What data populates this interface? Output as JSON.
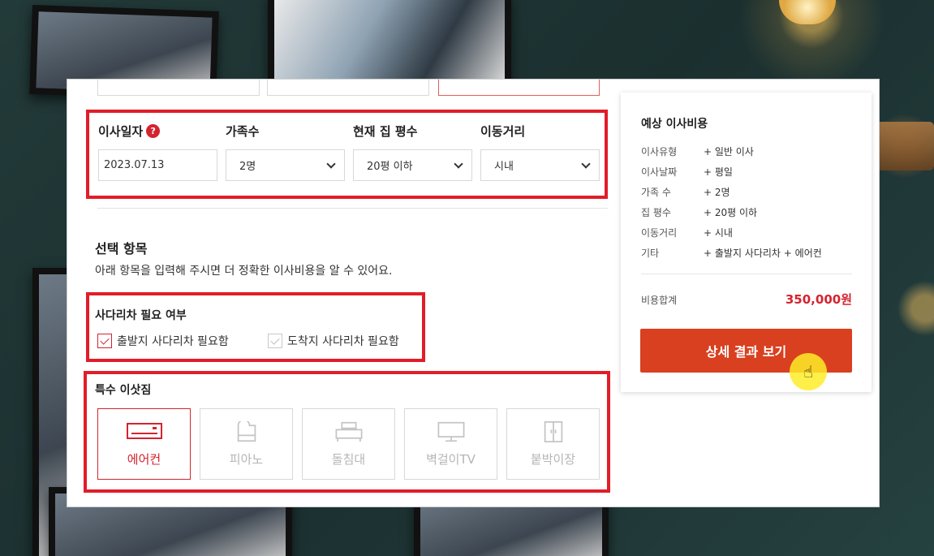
{
  "move_info": {
    "fields": [
      {
        "label": "이사일자",
        "value": "2023.07.13",
        "help": "?"
      },
      {
        "label": "가족수",
        "value": "2명"
      },
      {
        "label": "현재 집 평수",
        "value": "20평 이하"
      },
      {
        "label": "이동거리",
        "value": "시내"
      }
    ]
  },
  "optional": {
    "title": "선택 항목",
    "description": "아래 항목을 입력해 주시면 더 정확한 이사비용을 알 수 있어요.",
    "ladder": {
      "title": "사다리차 필요 여부",
      "options": [
        {
          "label": "출발지 사다리차 필요함",
          "checked": true
        },
        {
          "label": "도착지 사다리차 필요함",
          "checked": false
        }
      ]
    },
    "special": {
      "title": "특수 이삿짐",
      "items": [
        {
          "label": "에어컨",
          "icon": "air-conditioner-icon",
          "selected": true
        },
        {
          "label": "피아노",
          "icon": "piano-icon",
          "selected": false
        },
        {
          "label": "돌침대",
          "icon": "bed-icon",
          "selected": false
        },
        {
          "label": "벽걸이TV",
          "icon": "tv-icon",
          "selected": false
        },
        {
          "label": "붙박이장",
          "icon": "wardrobe-icon",
          "selected": false
        }
      ]
    }
  },
  "summary": {
    "title": "예상 이사비용",
    "rows": [
      {
        "key": "이사유형",
        "value": "+ 일반 이사"
      },
      {
        "key": "이사날짜",
        "value": "+ 평일"
      },
      {
        "key": "가족 수",
        "value": "+ 2명"
      },
      {
        "key": "집 평수",
        "value": "+ 20평 이하"
      },
      {
        "key": "이동거리",
        "value": "+ 시내"
      },
      {
        "key": "기타",
        "value": "+ 출발지 사다리차 + 에어컨"
      }
    ],
    "total_label": "비용합계",
    "total_value": "350,000원",
    "detail_button": "상세 결과 보기"
  },
  "colors": {
    "accent": "#d42430",
    "button": "#d8401f"
  }
}
